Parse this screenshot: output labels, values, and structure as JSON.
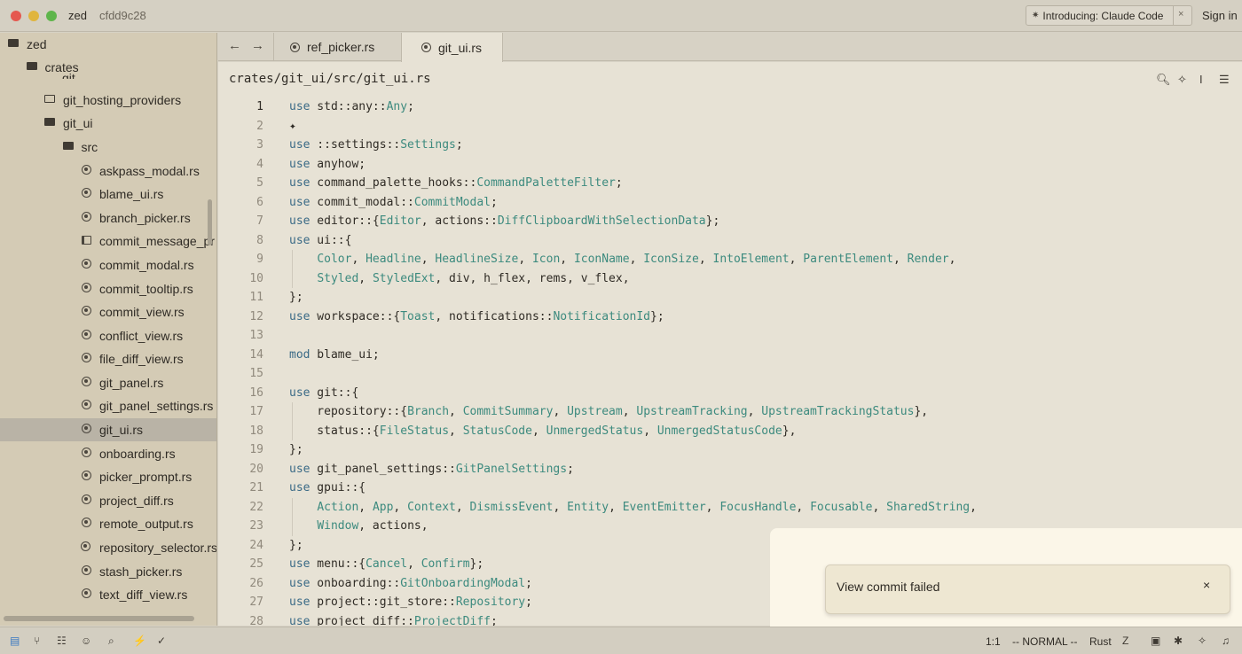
{
  "titlebar": {
    "app_name": "zed",
    "commit_hash": "cfdd9c28",
    "announcement": "Introducing: Claude Code",
    "close_glyph": "×",
    "sign_in": "Sign in"
  },
  "sidebar": {
    "peek_item": "git",
    "items": [
      {
        "label": "zed",
        "kind": "folder-open",
        "depth": 0
      },
      {
        "label": "crates",
        "kind": "folder-open",
        "depth": 1
      },
      {
        "label": "git_hosting_providers",
        "kind": "folder",
        "depth": 2
      },
      {
        "label": "git_ui",
        "kind": "folder-open",
        "depth": 2
      },
      {
        "label": "src",
        "kind": "folder-open",
        "depth": 3
      },
      {
        "label": "askpass_modal.rs",
        "kind": "rust",
        "depth": 4
      },
      {
        "label": "blame_ui.rs",
        "kind": "rust",
        "depth": 4
      },
      {
        "label": "branch_picker.rs",
        "kind": "rust",
        "depth": 4
      },
      {
        "label": "commit_message_pr",
        "kind": "book",
        "depth": 4
      },
      {
        "label": "commit_modal.rs",
        "kind": "rust",
        "depth": 4
      },
      {
        "label": "commit_tooltip.rs",
        "kind": "rust",
        "depth": 4
      },
      {
        "label": "commit_view.rs",
        "kind": "rust",
        "depth": 4
      },
      {
        "label": "conflict_view.rs",
        "kind": "rust",
        "depth": 4
      },
      {
        "label": "file_diff_view.rs",
        "kind": "rust",
        "depth": 4
      },
      {
        "label": "git_panel.rs",
        "kind": "rust",
        "depth": 4
      },
      {
        "label": "git_panel_settings.rs",
        "kind": "rust",
        "depth": 4
      },
      {
        "label": "git_ui.rs",
        "kind": "rust",
        "depth": 4,
        "selected": true
      },
      {
        "label": "onboarding.rs",
        "kind": "rust",
        "depth": 4
      },
      {
        "label": "picker_prompt.rs",
        "kind": "rust",
        "depth": 4
      },
      {
        "label": "project_diff.rs",
        "kind": "rust",
        "depth": 4
      },
      {
        "label": "remote_output.rs",
        "kind": "rust",
        "depth": 4
      },
      {
        "label": "repository_selector.rs",
        "kind": "rust",
        "depth": 4
      },
      {
        "label": "stash_picker.rs",
        "kind": "rust",
        "depth": 4
      },
      {
        "label": "text_diff_view.rs",
        "kind": "rust",
        "depth": 4
      }
    ]
  },
  "tabs": [
    {
      "label": "ref_picker.rs",
      "active": false
    },
    {
      "label": "git_ui.rs",
      "active": true
    }
  ],
  "nav": {
    "back_glyph": "←",
    "forward_glyph": "→"
  },
  "editor": {
    "breadcrumb": "crates/git_ui/src/git_ui.rs",
    "current_line": 1,
    "lines": [
      [
        [
          "kw",
          "use"
        ],
        [
          "p",
          " std::any::"
        ],
        [
          "ty",
          "Any"
        ],
        [
          "p",
          ";"
        ]
      ],
      [
        [
          "p",
          "✦"
        ]
      ],
      [
        [
          "kw",
          "use"
        ],
        [
          "p",
          " ::settings::"
        ],
        [
          "ty",
          "Settings"
        ],
        [
          "p",
          ";"
        ]
      ],
      [
        [
          "kw",
          "use"
        ],
        [
          "p",
          " anyhow;"
        ]
      ],
      [
        [
          "kw",
          "use"
        ],
        [
          "p",
          " command_palette_hooks::"
        ],
        [
          "ty",
          "CommandPaletteFilter"
        ],
        [
          "p",
          ";"
        ]
      ],
      [
        [
          "kw",
          "use"
        ],
        [
          "p",
          " commit_modal::"
        ],
        [
          "ty",
          "CommitModal"
        ],
        [
          "p",
          ";"
        ]
      ],
      [
        [
          "kw",
          "use"
        ],
        [
          "p",
          " editor::{"
        ],
        [
          "ty",
          "Editor"
        ],
        [
          "p",
          ", actions::"
        ],
        [
          "ty",
          "DiffClipboardWithSelectionData"
        ],
        [
          "p",
          "};"
        ]
      ],
      [
        [
          "kw",
          "use"
        ],
        [
          "p",
          " ui::{"
        ]
      ],
      [
        [
          "p",
          "    "
        ],
        [
          "ty",
          "Color"
        ],
        [
          "p",
          ", "
        ],
        [
          "ty",
          "Headline"
        ],
        [
          "p",
          ", "
        ],
        [
          "ty",
          "HeadlineSize"
        ],
        [
          "p",
          ", "
        ],
        [
          "ty",
          "Icon"
        ],
        [
          "p",
          ", "
        ],
        [
          "ty",
          "IconName"
        ],
        [
          "p",
          ", "
        ],
        [
          "ty",
          "IconSize"
        ],
        [
          "p",
          ", "
        ],
        [
          "ty",
          "IntoElement"
        ],
        [
          "p",
          ", "
        ],
        [
          "ty",
          "ParentElement"
        ],
        [
          "p",
          ", "
        ],
        [
          "ty",
          "Render"
        ],
        [
          "p",
          ","
        ]
      ],
      [
        [
          "p",
          "    "
        ],
        [
          "ty",
          "Styled"
        ],
        [
          "p",
          ", "
        ],
        [
          "ty",
          "StyledExt"
        ],
        [
          "p",
          ", div, h_flex, rems, v_flex,"
        ]
      ],
      [
        [
          "p",
          "};"
        ]
      ],
      [
        [
          "kw",
          "use"
        ],
        [
          "p",
          " workspace::{"
        ],
        [
          "ty",
          "Toast"
        ],
        [
          "p",
          ", notifications::"
        ],
        [
          "ty",
          "NotificationId"
        ],
        [
          "p",
          "};"
        ]
      ],
      [],
      [
        [
          "kw",
          "mod"
        ],
        [
          "p",
          " blame_ui;"
        ]
      ],
      [],
      [
        [
          "kw",
          "use"
        ],
        [
          "p",
          " git::{"
        ]
      ],
      [
        [
          "p",
          "    repository::{"
        ],
        [
          "ty",
          "Branch"
        ],
        [
          "p",
          ", "
        ],
        [
          "ty",
          "CommitSummary"
        ],
        [
          "p",
          ", "
        ],
        [
          "ty",
          "Upstream"
        ],
        [
          "p",
          ", "
        ],
        [
          "ty",
          "UpstreamTracking"
        ],
        [
          "p",
          ", "
        ],
        [
          "ty",
          "UpstreamTrackingStatus"
        ],
        [
          "p",
          "},"
        ]
      ],
      [
        [
          "p",
          "    status::{"
        ],
        [
          "ty",
          "FileStatus"
        ],
        [
          "p",
          ", "
        ],
        [
          "ty",
          "StatusCode"
        ],
        [
          "p",
          ", "
        ],
        [
          "ty",
          "UnmergedStatus"
        ],
        [
          "p",
          ", "
        ],
        [
          "ty",
          "UnmergedStatusCode"
        ],
        [
          "p",
          "},"
        ]
      ],
      [
        [
          "p",
          "};"
        ]
      ],
      [
        [
          "kw",
          "use"
        ],
        [
          "p",
          " git_panel_settings::"
        ],
        [
          "ty",
          "GitPanelSettings"
        ],
        [
          "p",
          ";"
        ]
      ],
      [
        [
          "kw",
          "use"
        ],
        [
          "p",
          " gpui::{"
        ]
      ],
      [
        [
          "p",
          "    "
        ],
        [
          "ty",
          "Action"
        ],
        [
          "p",
          ", "
        ],
        [
          "ty",
          "App"
        ],
        [
          "p",
          ", "
        ],
        [
          "ty",
          "Context"
        ],
        [
          "p",
          ", "
        ],
        [
          "ty",
          "DismissEvent"
        ],
        [
          "p",
          ", "
        ],
        [
          "ty",
          "Entity"
        ],
        [
          "p",
          ", "
        ],
        [
          "ty",
          "EventEmitter"
        ],
        [
          "p",
          ", "
        ],
        [
          "ty",
          "FocusHandle"
        ],
        [
          "p",
          ", "
        ],
        [
          "ty",
          "Focusable"
        ],
        [
          "p",
          ", "
        ],
        [
          "ty",
          "SharedString"
        ],
        [
          "p",
          ","
        ]
      ],
      [
        [
          "p",
          "    "
        ],
        [
          "ty",
          "Window"
        ],
        [
          "p",
          ", actions,"
        ]
      ],
      [
        [
          "p",
          "};"
        ]
      ],
      [
        [
          "kw",
          "use"
        ],
        [
          "p",
          " menu::{"
        ],
        [
          "ty",
          "Cancel"
        ],
        [
          "p",
          ", "
        ],
        [
          "ty",
          "Confirm"
        ],
        [
          "p",
          "};"
        ]
      ],
      [
        [
          "kw",
          "use"
        ],
        [
          "p",
          " onboarding::"
        ],
        [
          "ty",
          "GitOnboardingModal"
        ],
        [
          "p",
          ";"
        ]
      ],
      [
        [
          "kw",
          "use"
        ],
        [
          "p",
          " project::git_store::"
        ],
        [
          "ty",
          "Repository"
        ],
        [
          "p",
          ";"
        ]
      ],
      [
        [
          "kw",
          "use"
        ],
        [
          "p",
          " project_diff::"
        ],
        [
          "ty",
          "ProjectDiff"
        ],
        [
          "p",
          ";"
        ]
      ]
    ]
  },
  "toast": {
    "message": "View commit failed",
    "close_glyph": "×"
  },
  "status": {
    "cursor": "1:1",
    "mode": "-- NORMAL --",
    "language": "Rust"
  }
}
